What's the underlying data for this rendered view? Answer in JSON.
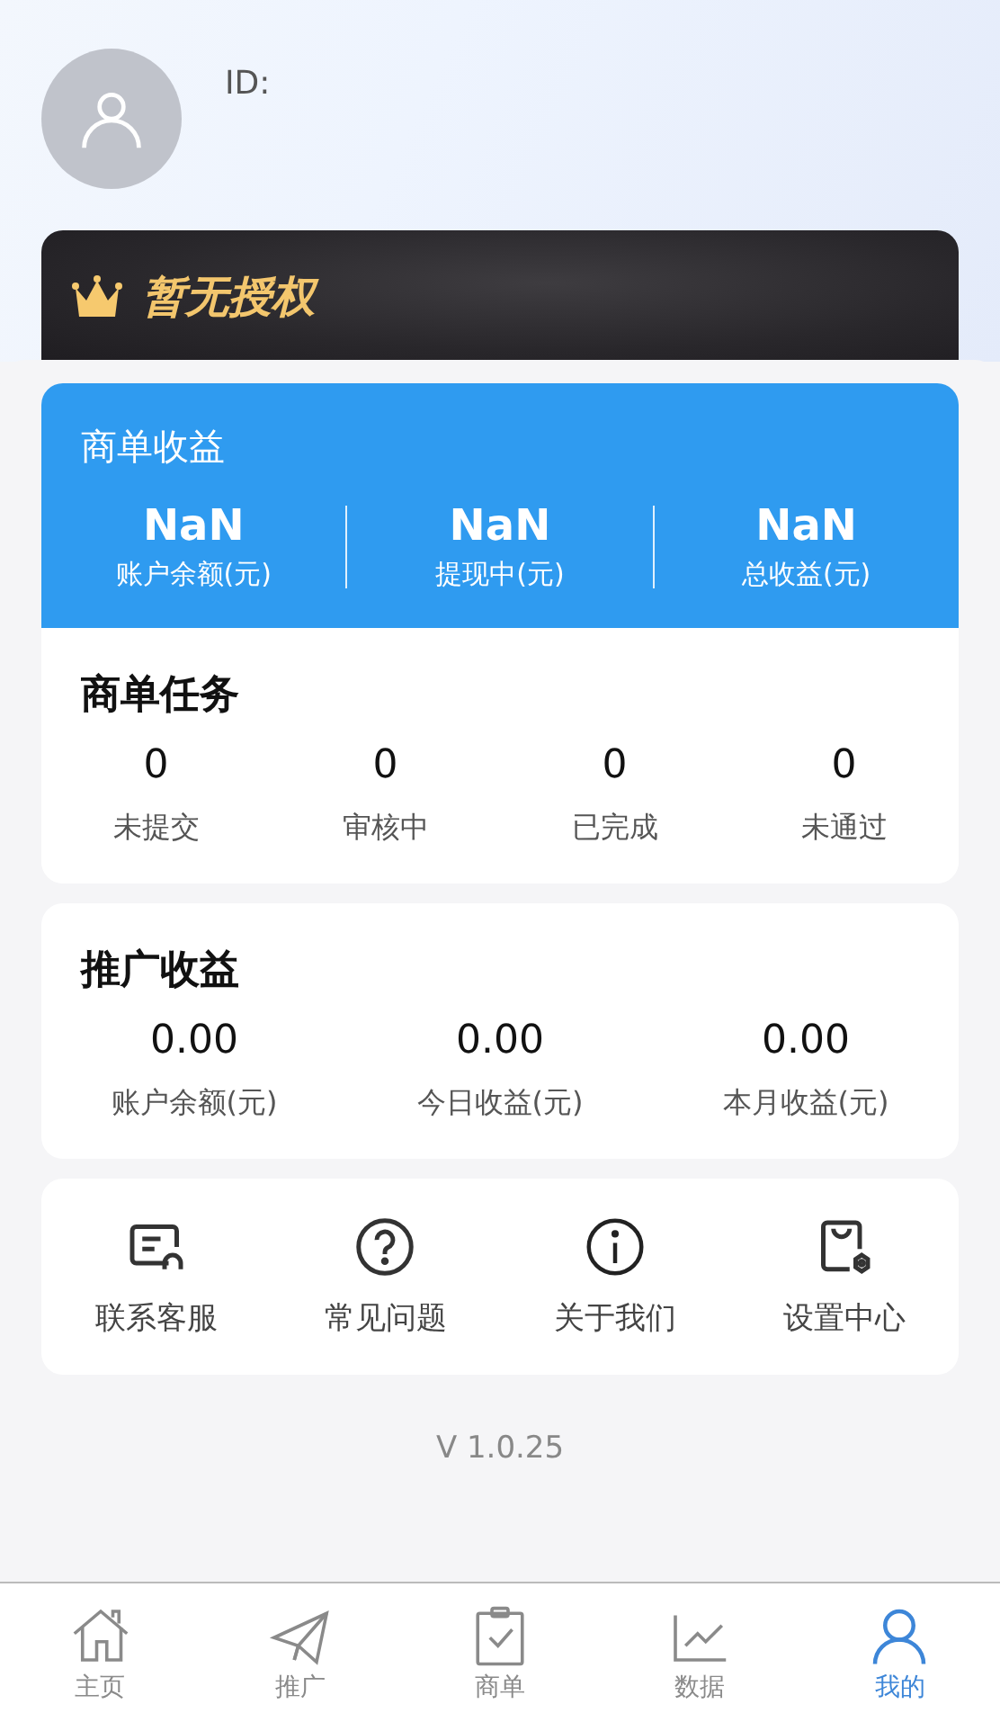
{
  "profile": {
    "id_label": "ID:"
  },
  "license": {
    "label": "暂无授权"
  },
  "merchant_income": {
    "title": "商单收益",
    "stats": [
      {
        "value": "NaN",
        "label": "账户余额(元)"
      },
      {
        "value": "NaN",
        "label": "提现中(元)"
      },
      {
        "value": "NaN",
        "label": "总收益(元)"
      }
    ]
  },
  "merchant_tasks": {
    "title": "商单任务",
    "stats": [
      {
        "value": "0",
        "label": "未提交"
      },
      {
        "value": "0",
        "label": "审核中"
      },
      {
        "value": "0",
        "label": "已完成"
      },
      {
        "value": "0",
        "label": "未通过"
      }
    ]
  },
  "promo_income": {
    "title": "推广收益",
    "stats": [
      {
        "value": "0.00",
        "label": "账户余额(元)"
      },
      {
        "value": "0.00",
        "label": "今日收益(元)"
      },
      {
        "value": "0.00",
        "label": "本月收益(元)"
      }
    ]
  },
  "shortcuts": [
    {
      "kind": "support",
      "label": "联系客服"
    },
    {
      "kind": "faq",
      "label": "常见问题"
    },
    {
      "kind": "about",
      "label": "关于我们"
    },
    {
      "kind": "settings",
      "label": "设置中心"
    }
  ],
  "version": "V 1.0.25",
  "tab_bar": [
    {
      "kind": "home",
      "label": "主页",
      "selected": false
    },
    {
      "kind": "promo",
      "label": "推广",
      "selected": false
    },
    {
      "kind": "orders",
      "label": "商单",
      "selected": false
    },
    {
      "kind": "data",
      "label": "数据",
      "selected": false
    },
    {
      "kind": "me",
      "label": "我的",
      "selected": true
    }
  ]
}
